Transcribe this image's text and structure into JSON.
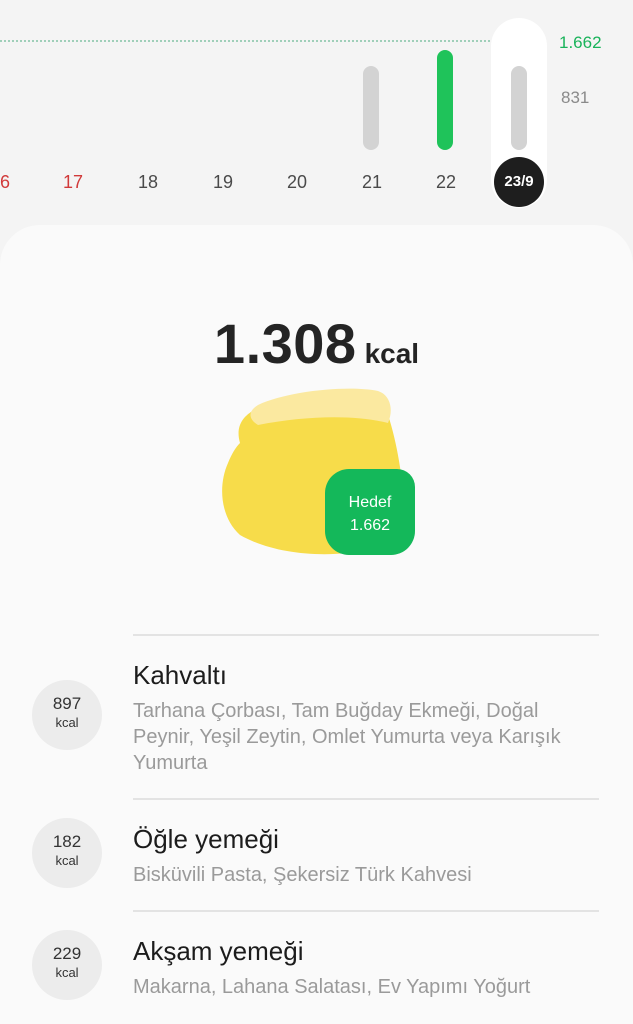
{
  "chart": {
    "goal_value": "1.662",
    "mid_value": "831",
    "days": [
      {
        "label": "6",
        "style": "red"
      },
      {
        "label": "17",
        "style": "red"
      },
      {
        "label": "18",
        "style": ""
      },
      {
        "label": "19",
        "style": ""
      },
      {
        "label": "20",
        "style": ""
      },
      {
        "label": "21",
        "style": ""
      },
      {
        "label": "22",
        "style": ""
      },
      {
        "label": "23/9",
        "style": "selected"
      }
    ],
    "bars": [
      {
        "day": "21",
        "color": "#d3d3d3"
      },
      {
        "day": "22",
        "color": "#1fc35a"
      },
      {
        "day": "23/9",
        "color": "#d3d3d3"
      }
    ]
  },
  "summary": {
    "total_value": "1.308",
    "total_unit": "kcal",
    "goal_label": "Hedef",
    "goal_value": "1.662"
  },
  "meals": [
    {
      "kcal": "897",
      "unit": "kcal",
      "title": "Kahvaltı",
      "items": "Tarhana Çorbası, Tam Buğday Ekmeği, Doğal Peynir, Yeşil Zeytin, Omlet Yumurta veya Karışık Yumurta"
    },
    {
      "kcal": "182",
      "unit": "kcal",
      "title": "Öğle yemeği",
      "items": "Bisküvili Pasta, Şekersiz Türk Kahvesi"
    },
    {
      "kcal": "229",
      "unit": "kcal",
      "title": "Akşam yemeği",
      "items": "Makarna, Lahana Salatası, Ev Yapımı Yoğurt"
    }
  ],
  "colors": {
    "accent_green": "#1fc35a",
    "food_yellow": "#f7dc4a",
    "weekend_red": "#d13a3a"
  }
}
